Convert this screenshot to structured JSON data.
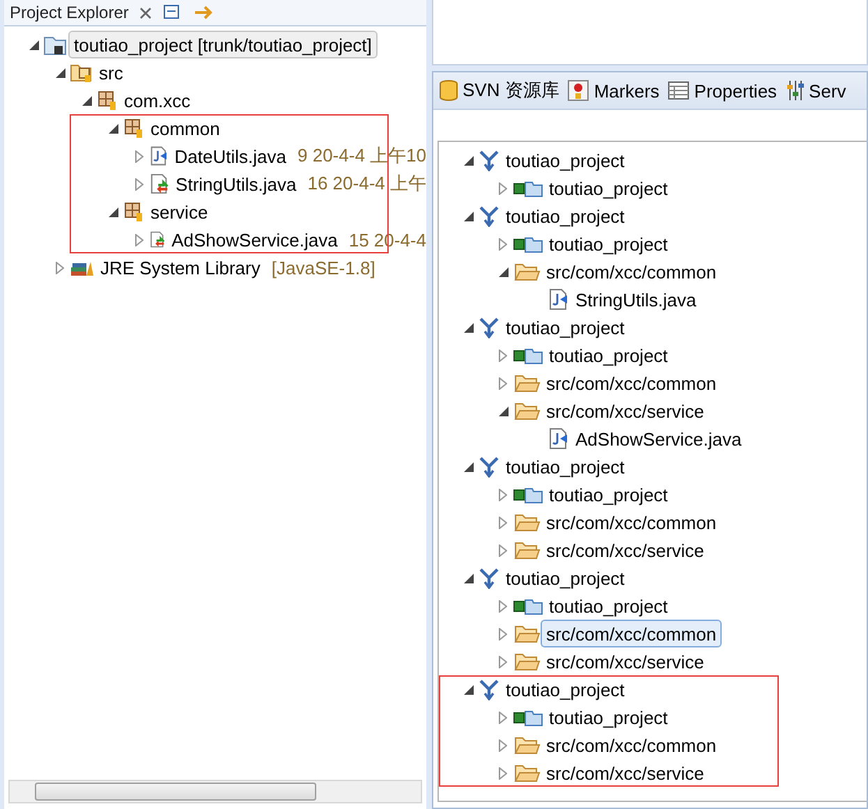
{
  "project_explorer": {
    "title": "Project Explorer",
    "tree": [
      {
        "kind": "project",
        "label": "toutiao_project [trunk/toutiao_project]",
        "expanded": true,
        "selected": true,
        "children": [
          {
            "kind": "source-folder",
            "label": "src",
            "expanded": true,
            "selected": false,
            "children": [
              {
                "kind": "package",
                "label": "com.xcc",
                "expanded": true,
                "selected": false,
                "outlined_children": true,
                "children": [
                  {
                    "kind": "package",
                    "label": "common",
                    "expanded": true,
                    "selected": false,
                    "children": [
                      {
                        "kind": "java-file",
                        "label": "DateUtils.java",
                        "info": "9  20-4-4 上午10",
                        "expanded": false,
                        "selected": false
                      },
                      {
                        "kind": "changed-file",
                        "label": "StringUtils.java",
                        "info": "16  20-4-4 上午",
                        "expanded": false,
                        "selected": false
                      }
                    ]
                  },
                  {
                    "kind": "package",
                    "label": "service",
                    "expanded": true,
                    "selected": false,
                    "children": [
                      {
                        "kind": "changed-file",
                        "label": "AdShowService.java",
                        "info": "15  20-4-4",
                        "expanded": false,
                        "selected": false
                      }
                    ]
                  }
                ]
              }
            ]
          },
          {
            "kind": "library",
            "label": "JRE System Library",
            "info": "[JavaSE-1.8]",
            "expanded": false,
            "selected": false
          }
        ]
      }
    ]
  },
  "tabs": [
    {
      "label": "SVN 资源库",
      "kind": "repository"
    },
    {
      "label": "Markers",
      "kind": "markers"
    },
    {
      "label": "Properties",
      "kind": "properties"
    },
    {
      "label": "Serv",
      "kind": "servers"
    }
  ],
  "history": [
    {
      "kind": "revision",
      "label": "toutiao_project",
      "expanded": true,
      "selected": false,
      "outlined": false,
      "children": [
        {
          "kind": "svn-project",
          "label": "toutiao_project",
          "expanded": false,
          "selected": false
        }
      ]
    },
    {
      "kind": "revision",
      "label": "toutiao_project",
      "expanded": true,
      "selected": false,
      "outlined": false,
      "children": [
        {
          "kind": "svn-project",
          "label": "toutiao_project",
          "expanded": false,
          "selected": false
        },
        {
          "kind": "folder",
          "label": "src/com/xcc/common",
          "expanded": true,
          "selected": false,
          "children": [
            {
              "kind": "java-file",
              "label": "StringUtils.java",
              "selected": false
            }
          ]
        }
      ]
    },
    {
      "kind": "revision",
      "label": "toutiao_project",
      "expanded": true,
      "selected": false,
      "outlined": false,
      "children": [
        {
          "kind": "svn-project",
          "label": "toutiao_project",
          "expanded": false,
          "selected": false
        },
        {
          "kind": "folder",
          "label": "src/com/xcc/common",
          "expanded": false,
          "selected": false
        },
        {
          "kind": "folder",
          "label": "src/com/xcc/service",
          "expanded": true,
          "selected": false,
          "children": [
            {
              "kind": "java-file",
              "label": "AdShowService.java",
              "selected": false
            }
          ]
        }
      ]
    },
    {
      "kind": "revision",
      "label": "toutiao_project",
      "expanded": true,
      "selected": false,
      "outlined": false,
      "children": [
        {
          "kind": "svn-project",
          "label": "toutiao_project",
          "expanded": false,
          "selected": false
        },
        {
          "kind": "folder",
          "label": "src/com/xcc/common",
          "expanded": false,
          "selected": false
        },
        {
          "kind": "folder",
          "label": "src/com/xcc/service",
          "expanded": false,
          "selected": false
        }
      ]
    },
    {
      "kind": "revision",
      "label": "toutiao_project",
      "expanded": true,
      "selected": false,
      "outlined": false,
      "children": [
        {
          "kind": "svn-project",
          "label": "toutiao_project",
          "expanded": false,
          "selected": false
        },
        {
          "kind": "folder",
          "label": "src/com/xcc/common",
          "expanded": false,
          "selected": true
        },
        {
          "kind": "folder",
          "label": "src/com/xcc/service",
          "expanded": false,
          "selected": false
        }
      ]
    },
    {
      "kind": "revision",
      "label": "toutiao_project",
      "expanded": true,
      "selected": false,
      "outlined": true,
      "children": [
        {
          "kind": "svn-project",
          "label": "toutiao_project",
          "expanded": false,
          "selected": false
        },
        {
          "kind": "folder",
          "label": "src/com/xcc/common",
          "expanded": false,
          "selected": false
        },
        {
          "kind": "folder",
          "label": "src/com/xcc/service",
          "expanded": false,
          "selected": false
        }
      ]
    }
  ]
}
